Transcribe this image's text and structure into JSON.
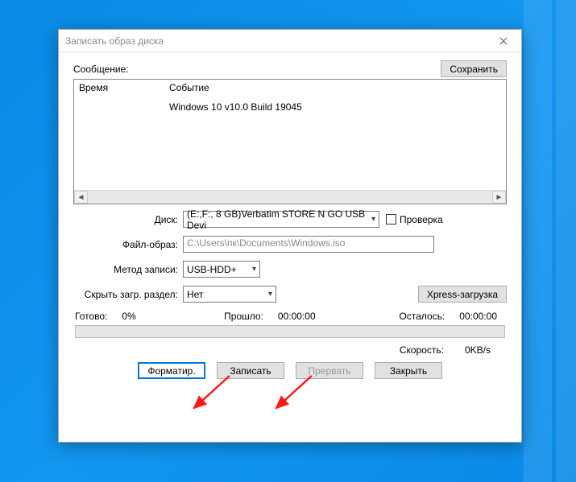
{
  "window": {
    "title": "Записать образ диска"
  },
  "top": {
    "message_label": "Сообщение:",
    "save_button": "Сохранить"
  },
  "log": {
    "col_time": "Время",
    "col_event": "Событие",
    "event_text": "Windows 10 v10.0 Build 19045"
  },
  "form": {
    "disk_label": "Диск:",
    "disk_value": "(E:,F:, 8 GB)Verbatim STORE N GO USB Devi",
    "check_label": "Проверка",
    "file_label": "Файл-образ:",
    "file_value": "C:\\Users\\пк\\Documents\\Windows.iso",
    "method_label": "Метод записи:",
    "method_value": "USB-HDD+",
    "hide_label": "Скрыть загр. раздел:",
    "hide_value": "Нет",
    "xpress_button": "Xpress-загрузка"
  },
  "status": {
    "done_label": "Готово:",
    "done_value": "0%",
    "elapsed_label": "Прошло:",
    "elapsed_value": "00:00:00",
    "remain_label": "Осталось:",
    "remain_value": "00:00:00",
    "speed_label": "Скорость:",
    "speed_value": "0KB/s"
  },
  "buttons": {
    "format": "Форматир.",
    "write": "Записать",
    "abort": "Прервать",
    "close": "Закрыть"
  }
}
